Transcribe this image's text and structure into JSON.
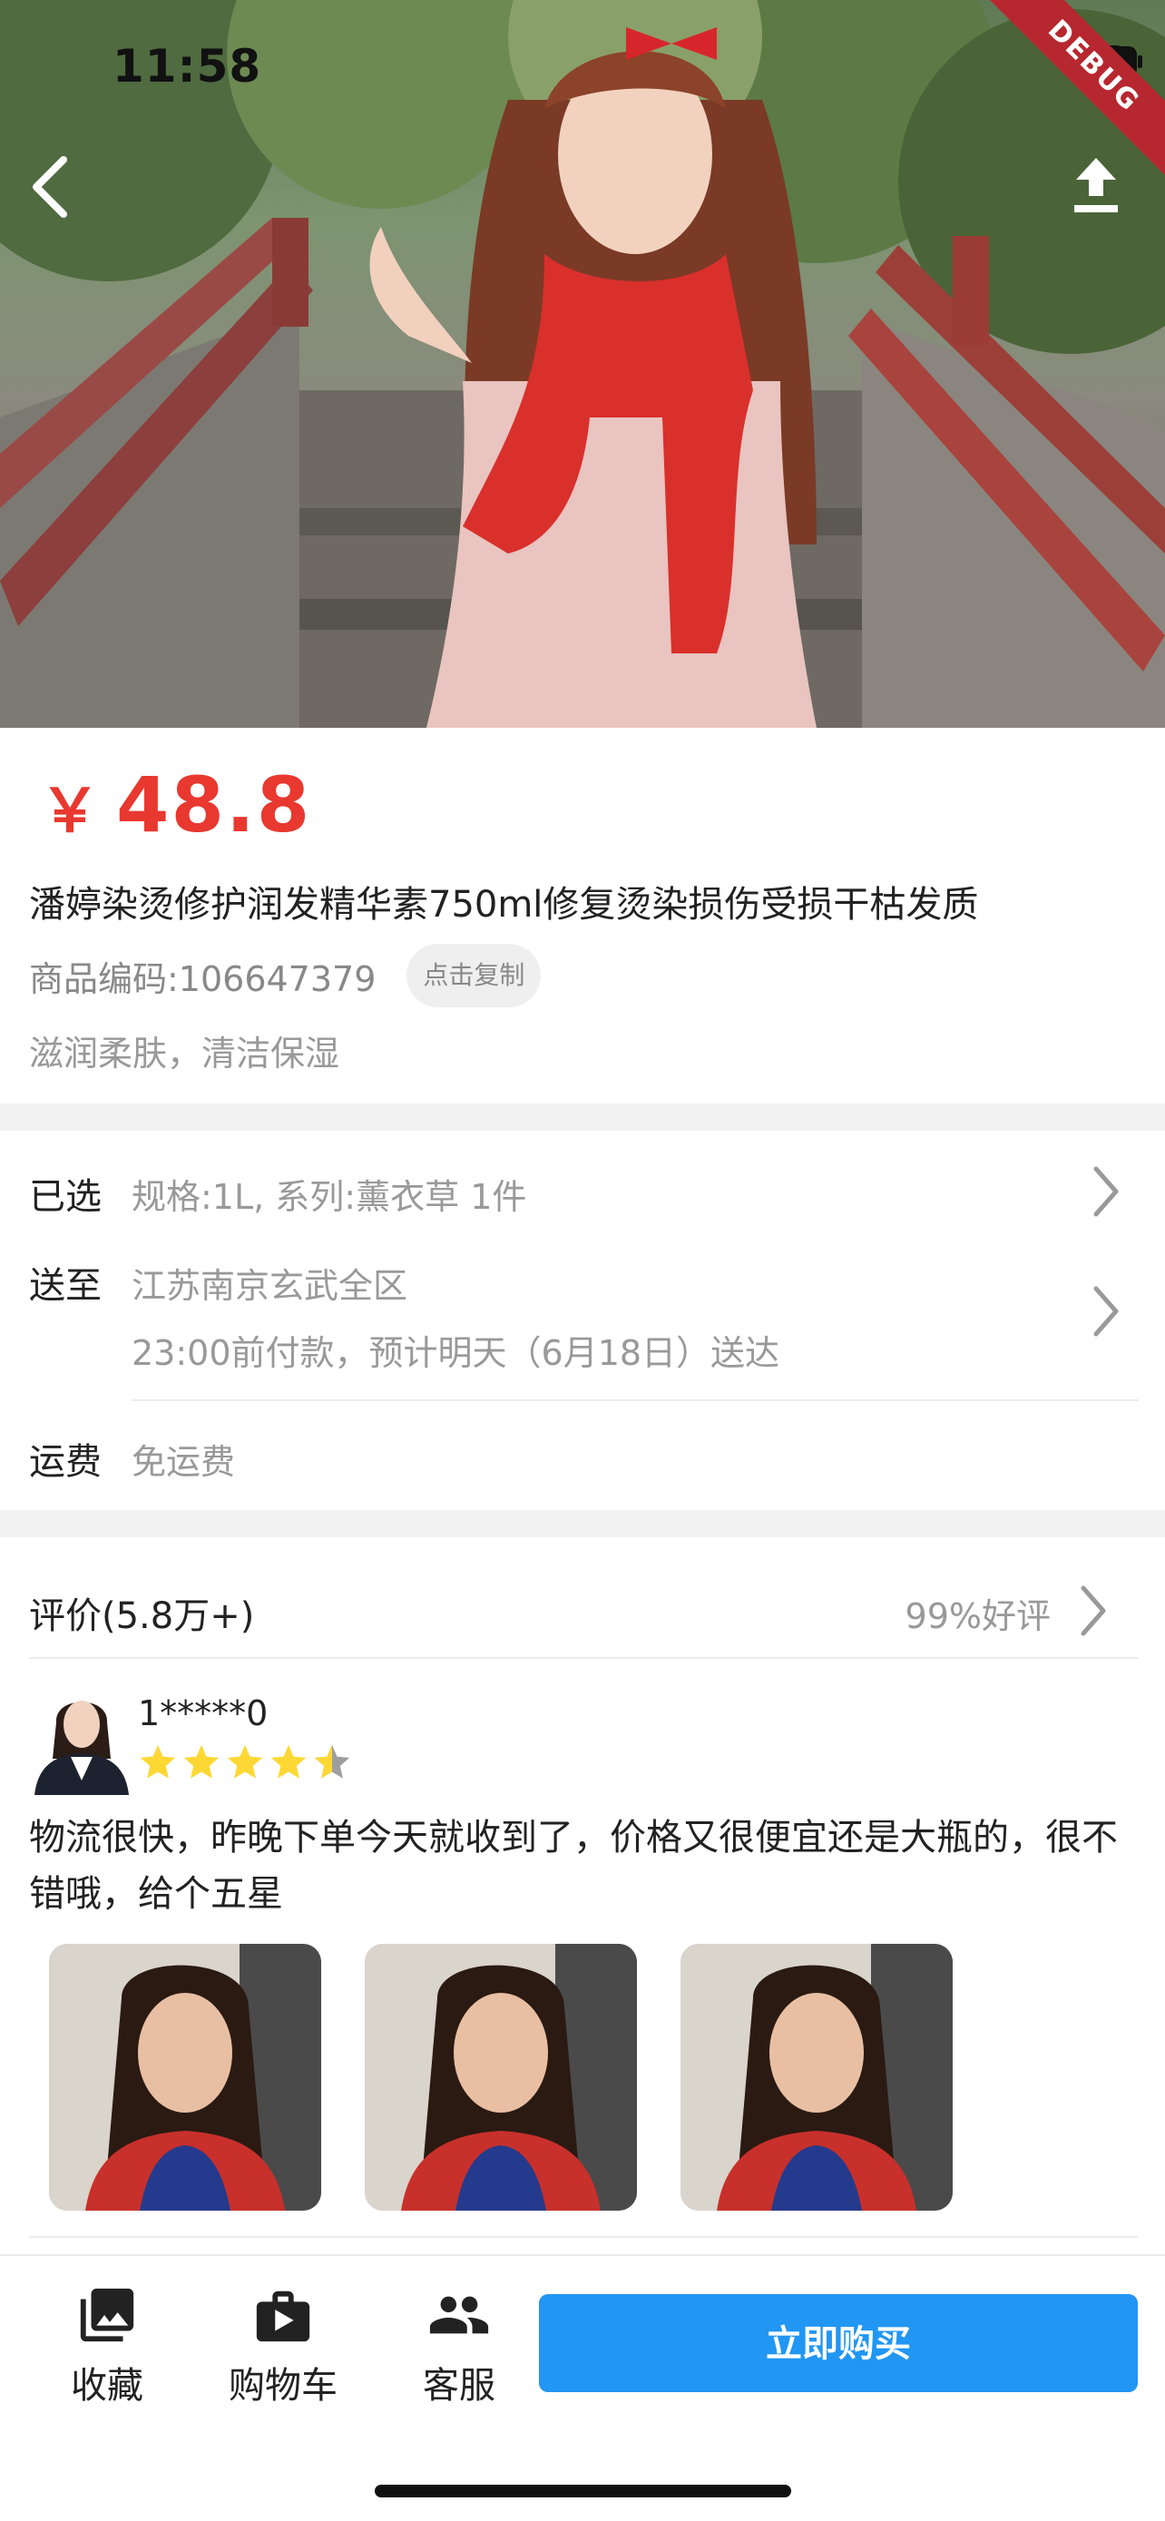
{
  "status": {
    "time": "11:58",
    "debug": "DEBUG"
  },
  "product": {
    "currency": "￥",
    "price": "48.8",
    "title": "潘婷染烫修护润发精华素750ml修复烫染损伤受损干枯发质",
    "code": "商品编码:106647379",
    "copy_label": "点击复制",
    "slogan": "滋润柔肤，清洁保湿"
  },
  "spec": {
    "selected_label": "已选",
    "selected_value": "规格:1L, 系列:薰衣草 1件",
    "ship_label": "送至",
    "ship_value": "江苏南京玄武全区",
    "ship_eta": "23:00前付款，预计明天（6月18日）送达",
    "freight_label": "运费",
    "freight_value": "免运费"
  },
  "review": {
    "title": "评价(5.8万+)",
    "rate": "99%好评",
    "user": "1*****0",
    "rating": 4.5,
    "comment": "物流很快，昨晚下单今天就收到了，价格又很便宜还是大瓶的，很不错哦，给个五星"
  },
  "bottom": {
    "fav": "收藏",
    "cart": "购物车",
    "service": "客服",
    "buy": "立即购买"
  },
  "colors": {
    "price": "#e8382f",
    "buy_button": "#2196f3",
    "star": "#fdd835"
  }
}
